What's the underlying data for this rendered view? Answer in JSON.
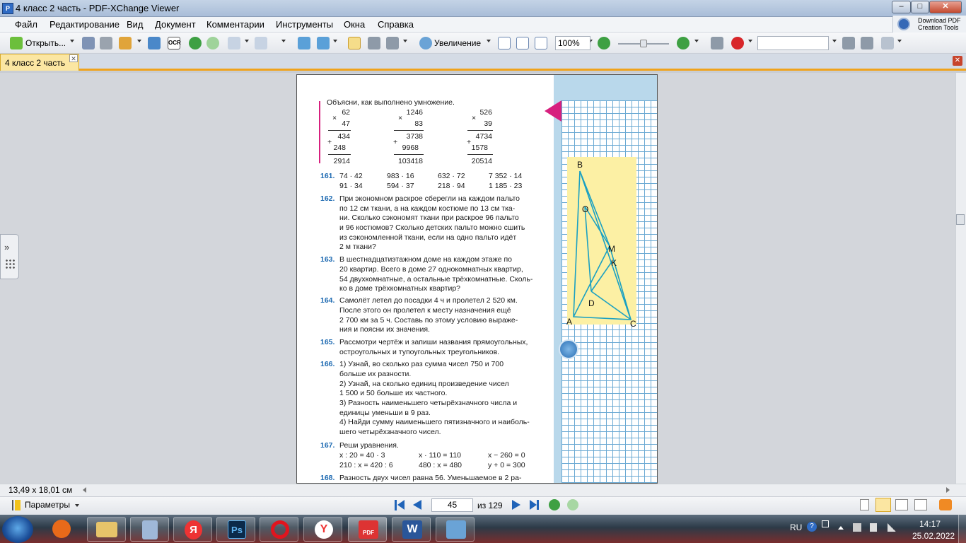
{
  "window": {
    "title": "4 класс 2 часть - PDF-XChange Viewer",
    "min": "–",
    "max": "□",
    "close": "✕"
  },
  "menu": [
    "Файл",
    "Редактирование",
    "Вид",
    "Документ",
    "Комментарии",
    "Инструменты",
    "Окна",
    "Справка"
  ],
  "download": {
    "line1": "Download PDF",
    "line2": "Creation Tools"
  },
  "toolbar": {
    "open_label": "Открыть...",
    "ocr_label": "OCR",
    "zoom_label": "Увеличение",
    "zoom_value": "100%"
  },
  "tab": {
    "label": "4 класс 2 часть",
    "close": "✕"
  },
  "status": {
    "page_size": "13,49 x 18,01 см",
    "params_label": "Параметры",
    "page_number": "45",
    "page_of": "из 129"
  },
  "taskbar": {
    "lang": "RU",
    "time": "14:17",
    "date": "25.02.2022"
  },
  "page": {
    "mult_heading": "Объясни, как выполнено умножение.",
    "mult": [
      {
        "a": "62",
        "b": "47",
        "p1": "434",
        "p2": "248",
        "res": "2914"
      },
      {
        "a": "1246",
        "b": "83",
        "p1": "3738",
        "p2": "9968",
        "res": "103418"
      },
      {
        "a": "526",
        "b": "39",
        "p1": "4734",
        "p2": "1578",
        "res": "20514"
      }
    ],
    "t161": {
      "num": "161.",
      "r1": [
        "74 · 42",
        "983 · 16",
        "632 · 72",
        "7 352 · 14"
      ],
      "r2": [
        "91 · 34",
        "594 · 37",
        "218 · 94",
        "1 185 · 23"
      ]
    },
    "t162": {
      "num": "162.",
      "lines": [
        "При экономном раскрое сберегли на каждом пальто",
        "по 12 см ткани, а на каждом костюме по 13 см тка-",
        "ни. Сколько сэкономят ткани при раскрое 96 пальто",
        "и 96 костюмов? Сколько детских пальто можно сшить",
        "из сэкономленной ткани, если на одно пальто идёт",
        "2 м ткани?"
      ]
    },
    "t163": {
      "num": "163.",
      "lines": [
        "В шестнадцатиэтажном доме на каждом этаже по",
        "20 квартир. Всего в доме 27 однокомнатных квартир,",
        "54 двухкомнатные, а остальные трёхкомнатные. Сколь-",
        "ко в доме трёхкомнатных квартир?"
      ]
    },
    "t164": {
      "num": "164.",
      "lines": [
        "Самолёт летел до посадки 4 ч и пролетел 2 520 км.",
        "После этого он пролетел к месту назначения ещё",
        "2 700 км за 5 ч. Составь по этому условию выраже-",
        "ния и поясни их значения."
      ]
    },
    "t165": {
      "num": "165.",
      "lines": [
        "Рассмотри чертёж и запиши названия прямоугольных,",
        "остроугольных и тупоугольных треугольников."
      ]
    },
    "t166": {
      "num": "166.",
      "lines": [
        "1) Узнай, во сколько раз сумма чисел 750 и 700",
        "больше их разности.",
        "2) Узнай, на сколько единиц произведение чисел",
        "1 500 и 50 больше их частного.",
        "3) Разность наименьшего четырёхзначного числа и",
        "единицы уменьши в 9 раз.",
        "4) Найди сумму наименьшего пятизначного и наиболь-",
        "шего четырёхзначного чисел."
      ]
    },
    "t167": {
      "num": "167.",
      "head": "Реши уравнения.",
      "r1": [
        "x : 20 = 40 · 3",
        "x · 110 = 110",
        "x − 260 = 0"
      ],
      "r2": [
        "210 : x = 420 : 6",
        "480 : x = 480",
        "y + 0 = 300"
      ]
    },
    "t168": {
      "num": "168.",
      "line": "Разность двух чисел равна 56. Уменьшаемое в 2 ра-"
    },
    "figure": {
      "points": [
        "B",
        "O",
        "M",
        "K",
        "D",
        "A",
        "C"
      ]
    }
  }
}
